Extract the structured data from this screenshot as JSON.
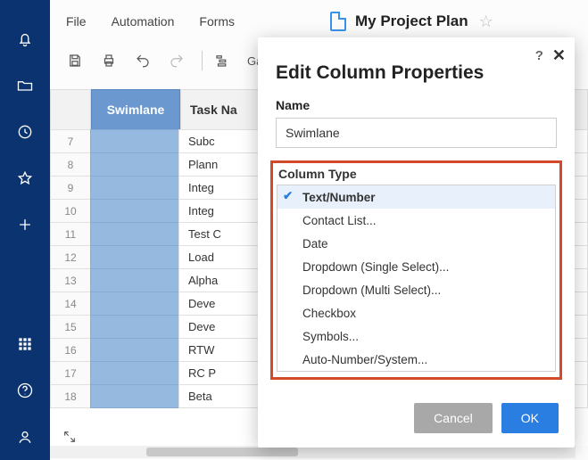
{
  "menu": {
    "file": "File",
    "automation": "Automation",
    "forms": "Forms"
  },
  "doc": {
    "title": "My Project Plan"
  },
  "toolbar": {
    "gantt_label": "Ga"
  },
  "grid": {
    "header_swimlane": "Swimlane",
    "header_task": "Task Na",
    "rows": [
      {
        "n": "7",
        "task": "Subc"
      },
      {
        "n": "8",
        "task": "Plann"
      },
      {
        "n": "9",
        "task": "Integ"
      },
      {
        "n": "10",
        "task": "Integ"
      },
      {
        "n": "11",
        "task": "Test C"
      },
      {
        "n": "12",
        "task": "Load"
      },
      {
        "n": "13",
        "task": "Alpha"
      },
      {
        "n": "14",
        "task": "Deve"
      },
      {
        "n": "15",
        "task": "Deve"
      },
      {
        "n": "16",
        "task": "RTW"
      },
      {
        "n": "17",
        "task": "RC P"
      },
      {
        "n": "18",
        "task": "Beta"
      }
    ]
  },
  "dialog": {
    "title": "Edit Column Properties",
    "name_label": "Name",
    "name_value": "Swimlane",
    "column_type_label": "Column Type",
    "types": {
      "text_number": "Text/Number",
      "contact_list": "Contact List...",
      "date": "Date",
      "dropdown_single": "Dropdown (Single Select)...",
      "dropdown_multi": "Dropdown (Multi Select)...",
      "checkbox": "Checkbox",
      "symbols": "Symbols...",
      "auto_number": "Auto-Number/System..."
    },
    "cancel": "Cancel",
    "ok": "OK"
  }
}
